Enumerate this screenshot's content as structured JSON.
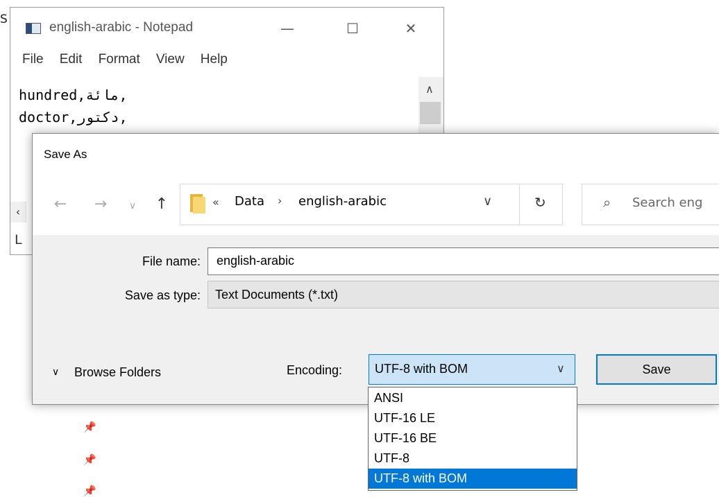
{
  "background": {
    "partial_letter": "S",
    "pin_icons": [
      "pin-icon",
      "pin-icon",
      "pin-icon"
    ]
  },
  "notepad": {
    "title": "english-arabic - Notepad",
    "menu": [
      "File",
      "Edit",
      "Format",
      "View",
      "Help"
    ],
    "lines": [
      "hundred,مائة,",
      "doctor,دكتور,"
    ],
    "status_partial": "L"
  },
  "dialog": {
    "title": "Save As",
    "address": {
      "segments": [
        "Data",
        "english-arabic"
      ]
    },
    "search_placeholder": "Search eng",
    "file_name_label": "File name:",
    "file_name_value": "english-arabic",
    "save_type_label": "Save as type:",
    "save_type_value": "Text Documents (*.txt)",
    "browse_folders": "Browse Folders",
    "encoding_label": "Encoding:",
    "encoding_value": "UTF-8 with BOM",
    "save_button": "Save",
    "encoding_options": [
      "ANSI",
      "UTF-16 LE",
      "UTF-16 BE",
      "UTF-8",
      "UTF-8 with BOM"
    ],
    "encoding_selected": "UTF-8 with BOM"
  },
  "colors": {
    "accent": "#0078d7",
    "select_bg": "#cce4f7",
    "folder": "#f8d775"
  }
}
